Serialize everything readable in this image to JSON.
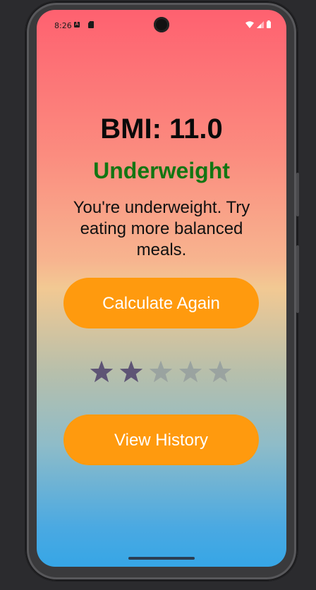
{
  "status_bar": {
    "time": "8:26",
    "notification_icon_letter": "A",
    "icons": [
      "wifi-icon",
      "signal-icon",
      "battery-icon"
    ]
  },
  "result": {
    "bmi_text": "BMI: 11.0",
    "category": "Underweight",
    "category_color": "#137613",
    "message": "You're underweight. Try eating more balanced meals."
  },
  "actions": {
    "calculate_again_label": "Calculate Again",
    "view_history_label": "View History",
    "button_color": "#ff9a0e"
  },
  "rating": {
    "value": 2,
    "max": 5,
    "filled_color": "#5e5475",
    "empty_color": "#9aa3a0"
  }
}
